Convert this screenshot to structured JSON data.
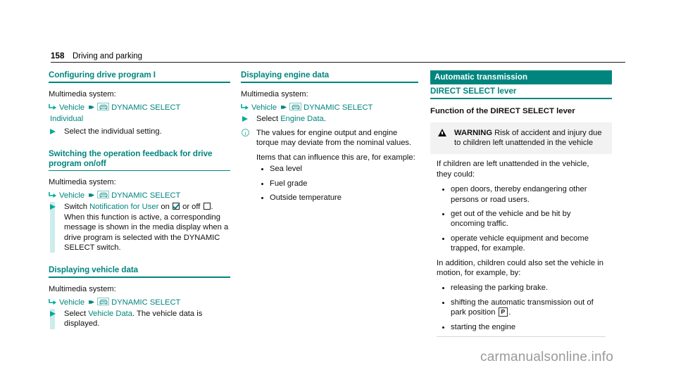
{
  "page": {
    "number": "158",
    "section": "Driving and parking",
    "watermark": "carmanualsonline.info"
  },
  "icons": {
    "return_arrow": "return-arrow-icon",
    "double_chevron": "double-chevron-icon",
    "dynamic_select": "dynamic-select-car-icon",
    "info": "info-icon",
    "warning": "warning-triangle-icon",
    "checkbox_checked": "checkbox-checked-icon",
    "checkbox_empty": "checkbox-empty-icon"
  },
  "colors": {
    "accent": "#00857e",
    "bar": "#cdeceb",
    "triangle": "#00a99d",
    "warn_bg": "#f2f2f2"
  },
  "col1": {
    "sections": [
      {
        "title": "Configuring drive program I",
        "lead": "Multimedia system:",
        "path": {
          "first": "Vehicle",
          "second": "DYNAMIC SELECT",
          "cont": "Individual"
        },
        "steps": [
          {
            "type": "arrow",
            "text": "Select the individual setting."
          }
        ]
      },
      {
        "title": "Switching the operation feedback for drive program on/off",
        "lead": "Multimedia system:",
        "path": {
          "first": "Vehicle",
          "second": "DYNAMIC SELECT"
        },
        "switch_step": {
          "pre": "Switch ",
          "menu_item": "Notification for User",
          "mid_on": " on ",
          "mid_or": " or off ",
          "tail": ".",
          "body": "When this function is active, a corresponding message is shown in the media display when a drive program is selected with the DYNAMIC SELECT switch."
        }
      },
      {
        "title": "Displaying vehicle data",
        "lead": "Multimedia system:",
        "path": {
          "first": "Vehicle",
          "second": "DYNAMIC SELECT"
        },
        "select_step": {
          "pre": "Select ",
          "menu_item": "Vehicle Data",
          "tail": ".",
          "body": "The vehicle data is displayed."
        }
      }
    ]
  },
  "col2": {
    "title": "Displaying engine data",
    "lead": "Multimedia system:",
    "path": {
      "first": "Vehicle",
      "second": "DYNAMIC SELECT"
    },
    "select_step": {
      "pre": "Select ",
      "menu_item": "Engine Data",
      "tail": "."
    },
    "info_step": {
      "text": "The values for engine output and engine torque may deviate from the nominal values.",
      "second": "Items that can influence this are, for example:"
    },
    "bullets": [
      "Sea level",
      "Fuel grade",
      "Outside temperature"
    ]
  },
  "col3": {
    "banner": "Automatic transmission",
    "subtitle": "DIRECT SELECT lever",
    "function_title": "Function of the DIRECT SELECT lever",
    "warning": {
      "label": "WARNING",
      "text": " Risk of accident and injury due to children left unattended in the vehicle"
    },
    "intro": "If children are left unattended in the vehicle, they could:",
    "bullets_1": [
      "open doors, thereby endangering other persons or road users.",
      "get out of the vehicle and be hit by oncoming traffic.",
      "operate vehicle equipment and become trapped, for example."
    ],
    "intro_2": "In addition, children could also set the vehicle in motion, for example, by:",
    "bullets_2_a": "releasing the parking brake.",
    "bullets_2_b_pre": "shifting the automatic transmission out of park position ",
    "bullets_2_b_badge": "P",
    "bullets_2_b_tail": ".",
    "bullets_2_c": "starting the engine"
  }
}
